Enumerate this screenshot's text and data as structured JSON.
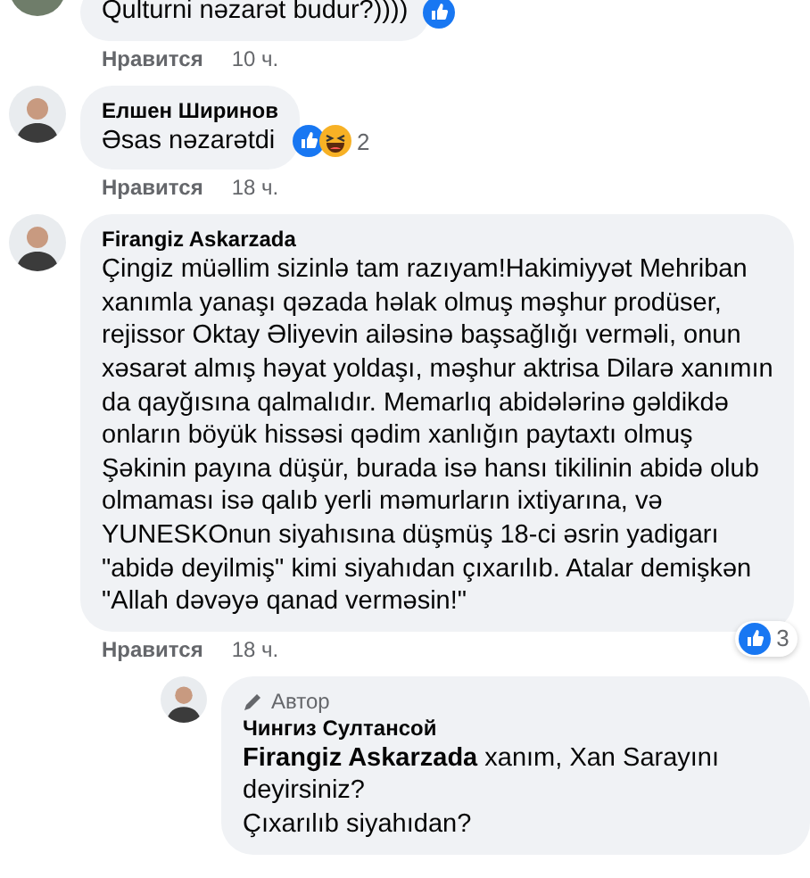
{
  "comments": [
    {
      "text": "Qulturni nəzarət budur?))))",
      "reactions": [
        {
          "kind": "like"
        }
      ],
      "like_label": "Нравится",
      "time": "10 ч."
    },
    {
      "author": "Елшен Ширинов",
      "text": "Əsas nəzarətdi",
      "reactions": [
        {
          "kind": "like"
        },
        {
          "kind": "haha"
        }
      ],
      "reaction_count": "2",
      "like_label": "Нравится",
      "time": "18 ч."
    },
    {
      "author": "Firangiz Askarzada",
      "text": "Çingiz müəllim sizinlə tam razıyam!Hakimiyyət Mehriban\nxanımla yanaşı qəzada həlak olmuş məşhur prodüser,\nrejissor Oktay Əliyevin ailəsinə başsağlığı verməli, onun\nxəsarət almış həyat yoldaşı, məşhur aktrisa Dilarə xanımın\nda qayğısına qalmalıdır. Memarlıq abidələrinə gəldikdə\nonların böyük hissəsi qədim xanlığın paytaxtı olmuş\nŞəkinin payına düşür, burada isə hansı tikilinin abidə olub\nolmaması isə qalıb yerli məmurların ixtiyarına, və\nYUNESKOnun siyahısına düşmüş 18-ci əsrin yadigarı\n\"abidə deyilmiş\" kimi siyahıdan çıxarılıb. Atalar demişkən\n\"Allah dəvəyə qanad verməsin!\"",
      "reactions": [
        {
          "kind": "like"
        }
      ],
      "reaction_count": "3",
      "like_label": "Нравится",
      "time": "18 ч.",
      "replies": [
        {
          "author": "Чингиз Султансой",
          "author_badge": "Автор",
          "mention": "Firangiz Askarzada",
          "text": " xanım, Xan Sarayını deyirsiniz?\nÇıxarılıb siyahıdan?"
        }
      ]
    }
  ]
}
